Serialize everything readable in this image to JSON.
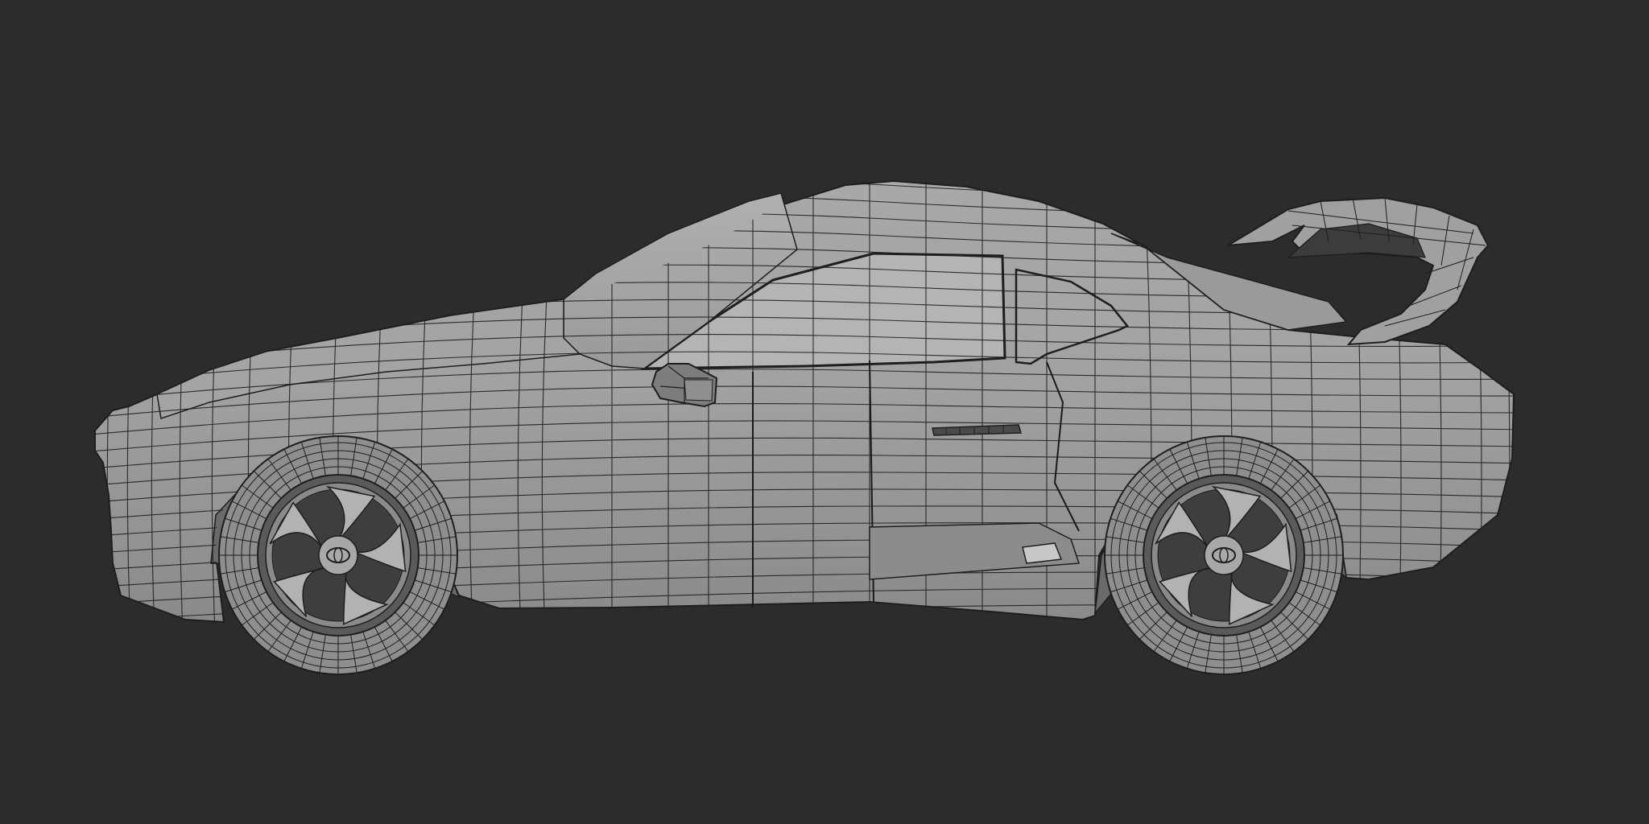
{
  "viewport": {
    "background_color": "#2c2c2c",
    "shading_mode": "solid",
    "overlay": "wireframe"
  },
  "model": {
    "subject": "sports car",
    "view": "side",
    "body_color": "#9e9e9e",
    "highlight_color": "#b9b9b9",
    "shadow_color": "#6e6e6e",
    "wire_color": "#1e1e1e",
    "parts": [
      "body",
      "spoiler",
      "side-mirror",
      "door-handle",
      "front-wheel",
      "rear-wheel"
    ]
  }
}
